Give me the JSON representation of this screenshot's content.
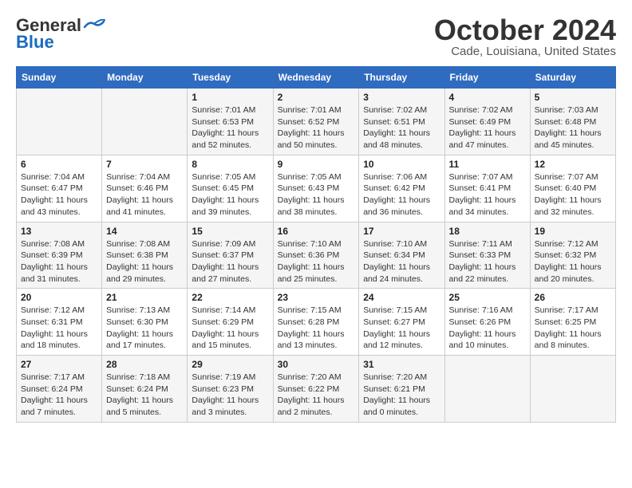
{
  "header": {
    "logo_line1": "General",
    "logo_line2": "Blue",
    "month": "October 2024",
    "location": "Cade, Louisiana, United States"
  },
  "weekdays": [
    "Sunday",
    "Monday",
    "Tuesday",
    "Wednesday",
    "Thursday",
    "Friday",
    "Saturday"
  ],
  "weeks": [
    [
      {
        "day": "",
        "info": ""
      },
      {
        "day": "",
        "info": ""
      },
      {
        "day": "1",
        "info": "Sunrise: 7:01 AM\nSunset: 6:53 PM\nDaylight: 11 hours and 52 minutes."
      },
      {
        "day": "2",
        "info": "Sunrise: 7:01 AM\nSunset: 6:52 PM\nDaylight: 11 hours and 50 minutes."
      },
      {
        "day": "3",
        "info": "Sunrise: 7:02 AM\nSunset: 6:51 PM\nDaylight: 11 hours and 48 minutes."
      },
      {
        "day": "4",
        "info": "Sunrise: 7:02 AM\nSunset: 6:49 PM\nDaylight: 11 hours and 47 minutes."
      },
      {
        "day": "5",
        "info": "Sunrise: 7:03 AM\nSunset: 6:48 PM\nDaylight: 11 hours and 45 minutes."
      }
    ],
    [
      {
        "day": "6",
        "info": "Sunrise: 7:04 AM\nSunset: 6:47 PM\nDaylight: 11 hours and 43 minutes."
      },
      {
        "day": "7",
        "info": "Sunrise: 7:04 AM\nSunset: 6:46 PM\nDaylight: 11 hours and 41 minutes."
      },
      {
        "day": "8",
        "info": "Sunrise: 7:05 AM\nSunset: 6:45 PM\nDaylight: 11 hours and 39 minutes."
      },
      {
        "day": "9",
        "info": "Sunrise: 7:05 AM\nSunset: 6:43 PM\nDaylight: 11 hours and 38 minutes."
      },
      {
        "day": "10",
        "info": "Sunrise: 7:06 AM\nSunset: 6:42 PM\nDaylight: 11 hours and 36 minutes."
      },
      {
        "day": "11",
        "info": "Sunrise: 7:07 AM\nSunset: 6:41 PM\nDaylight: 11 hours and 34 minutes."
      },
      {
        "day": "12",
        "info": "Sunrise: 7:07 AM\nSunset: 6:40 PM\nDaylight: 11 hours and 32 minutes."
      }
    ],
    [
      {
        "day": "13",
        "info": "Sunrise: 7:08 AM\nSunset: 6:39 PM\nDaylight: 11 hours and 31 minutes."
      },
      {
        "day": "14",
        "info": "Sunrise: 7:08 AM\nSunset: 6:38 PM\nDaylight: 11 hours and 29 minutes."
      },
      {
        "day": "15",
        "info": "Sunrise: 7:09 AM\nSunset: 6:37 PM\nDaylight: 11 hours and 27 minutes."
      },
      {
        "day": "16",
        "info": "Sunrise: 7:10 AM\nSunset: 6:36 PM\nDaylight: 11 hours and 25 minutes."
      },
      {
        "day": "17",
        "info": "Sunrise: 7:10 AM\nSunset: 6:34 PM\nDaylight: 11 hours and 24 minutes."
      },
      {
        "day": "18",
        "info": "Sunrise: 7:11 AM\nSunset: 6:33 PM\nDaylight: 11 hours and 22 minutes."
      },
      {
        "day": "19",
        "info": "Sunrise: 7:12 AM\nSunset: 6:32 PM\nDaylight: 11 hours and 20 minutes."
      }
    ],
    [
      {
        "day": "20",
        "info": "Sunrise: 7:12 AM\nSunset: 6:31 PM\nDaylight: 11 hours and 18 minutes."
      },
      {
        "day": "21",
        "info": "Sunrise: 7:13 AM\nSunset: 6:30 PM\nDaylight: 11 hours and 17 minutes."
      },
      {
        "day": "22",
        "info": "Sunrise: 7:14 AM\nSunset: 6:29 PM\nDaylight: 11 hours and 15 minutes."
      },
      {
        "day": "23",
        "info": "Sunrise: 7:15 AM\nSunset: 6:28 PM\nDaylight: 11 hours and 13 minutes."
      },
      {
        "day": "24",
        "info": "Sunrise: 7:15 AM\nSunset: 6:27 PM\nDaylight: 11 hours and 12 minutes."
      },
      {
        "day": "25",
        "info": "Sunrise: 7:16 AM\nSunset: 6:26 PM\nDaylight: 11 hours and 10 minutes."
      },
      {
        "day": "26",
        "info": "Sunrise: 7:17 AM\nSunset: 6:25 PM\nDaylight: 11 hours and 8 minutes."
      }
    ],
    [
      {
        "day": "27",
        "info": "Sunrise: 7:17 AM\nSunset: 6:24 PM\nDaylight: 11 hours and 7 minutes."
      },
      {
        "day": "28",
        "info": "Sunrise: 7:18 AM\nSunset: 6:24 PM\nDaylight: 11 hours and 5 minutes."
      },
      {
        "day": "29",
        "info": "Sunrise: 7:19 AM\nSunset: 6:23 PM\nDaylight: 11 hours and 3 minutes."
      },
      {
        "day": "30",
        "info": "Sunrise: 7:20 AM\nSunset: 6:22 PM\nDaylight: 11 hours and 2 minutes."
      },
      {
        "day": "31",
        "info": "Sunrise: 7:20 AM\nSunset: 6:21 PM\nDaylight: 11 hours and 0 minutes."
      },
      {
        "day": "",
        "info": ""
      },
      {
        "day": "",
        "info": ""
      }
    ]
  ]
}
